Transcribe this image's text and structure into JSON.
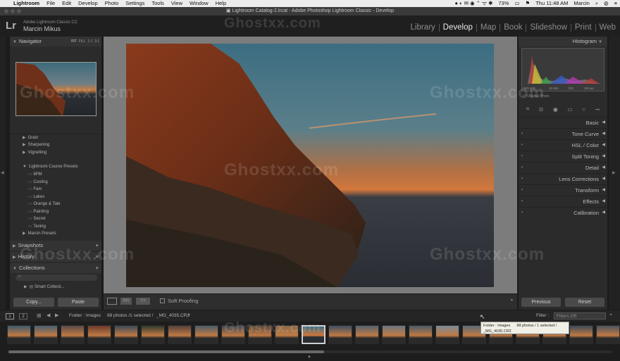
{
  "menubar": {
    "app": "Lightroom",
    "items": [
      "File",
      "Edit",
      "Develop",
      "Photo",
      "Settings",
      "Tools",
      "View",
      "Window",
      "Help"
    ],
    "battery": "73%",
    "clock": "Thu 11:48 AM",
    "user": "Marcin"
  },
  "window": {
    "title": "Lightroom Catalog-2.lrcat - Adobe Photoshop Lightroom Classic - Develop"
  },
  "identity": {
    "logo": "Lr",
    "subtitle": "Adobe Lightroom Classic CC",
    "name": "Marcin Mikus"
  },
  "modules": [
    "Library",
    "Develop",
    "Map",
    "Book",
    "Slideshow",
    "Print",
    "Web"
  ],
  "left": {
    "navigator": {
      "title": "Navigator",
      "zoom": [
        "FIT",
        "FILL",
        "1:1",
        "3:1"
      ]
    },
    "presets_partial": "Grain",
    "presets": [
      "Sharpening",
      "Vignetting"
    ],
    "course_presets": {
      "label": "Lightroom Course Presets",
      "items": [
        "6PM",
        "Cooling",
        "Fam",
        "Lakes",
        "Orange & Tale",
        "Painting",
        "Secret",
        "Taning"
      ]
    },
    "marcin_presets": "Marcin Presets",
    "snapshots": "Snapshots",
    "history": "History",
    "collections": "Collections",
    "smart_collections": "Smart Collecti..."
  },
  "buttons": {
    "copy": "Copy...",
    "paste": "Paste",
    "previous": "Previous",
    "reset": "Reset"
  },
  "toolbar": {
    "soft_proofing": "Soft Proofing"
  },
  "right": {
    "histogram": "Histogram",
    "hist_readouts": [
      "ISO 100",
      "13 mm",
      "f/11",
      "1/8 sec"
    ],
    "original_photo": "Original Photo",
    "panels": [
      "Basic",
      "Tone Curve",
      "HSL / Color",
      "Split Toning",
      "Detail",
      "Lens Corrections",
      "Transform",
      "Effects",
      "Calibration"
    ]
  },
  "filmstrip": {
    "pages": [
      "1",
      "2"
    ],
    "source": "Folder : Images",
    "count": "88 photos /1 selected /",
    "file": "_MG_4035.CR2",
    "filter_label": "Filter :",
    "filter_value": "Filters Off",
    "tooltip_line1": "Folder : Images",
    "tooltip_count": "88 photos / 1 selected /",
    "tooltip_file": "_MG_4035.CR2"
  },
  "watermark": "Ghostxx.com",
  "colors": {
    "accent_module": "#e8e8e8",
    "panel_bg": "#2b2b2b",
    "sky_top": "#3f6d80",
    "sunset": "#d0733a"
  }
}
